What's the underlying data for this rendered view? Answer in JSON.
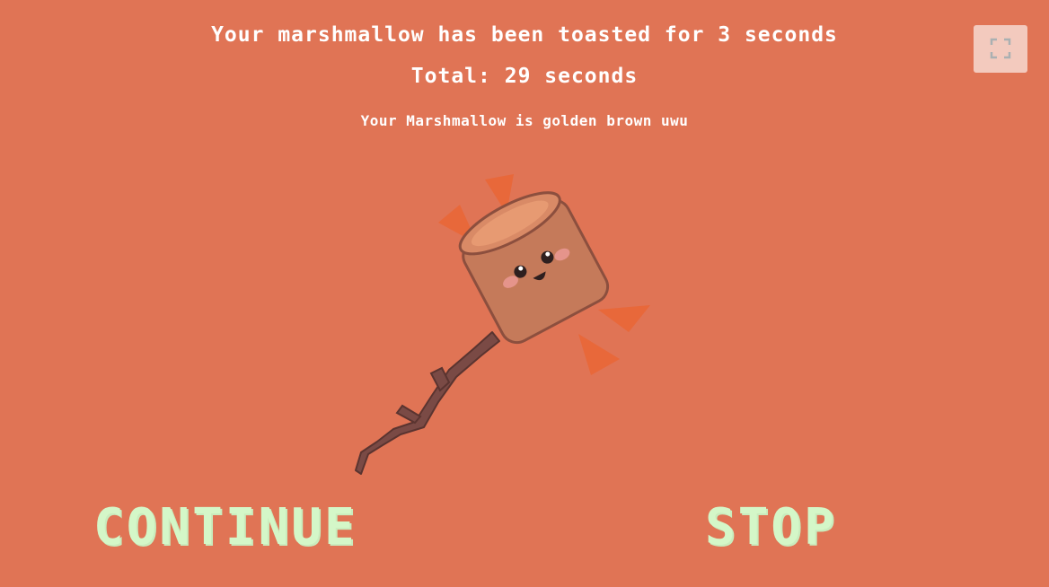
{
  "colors": {
    "background": "#e07455",
    "text": "#ffffff",
    "button_text": "#d4f7c8",
    "marshmallow": "#c57a5a",
    "stick": "#7a4a45",
    "sparkle": "#e8683a"
  },
  "status": {
    "toasted_message": "Your marshmallow has been toasted for 3 seconds",
    "total_message": "Total: 29 seconds",
    "doneness_message": "Your Marshmallow is golden brown uwu"
  },
  "controls": {
    "fullscreen_icon": "fullscreen-icon",
    "continue_label": "CONTINUE",
    "stop_label": "STOP"
  },
  "illustration": {
    "name": "marshmallow-on-stick"
  }
}
